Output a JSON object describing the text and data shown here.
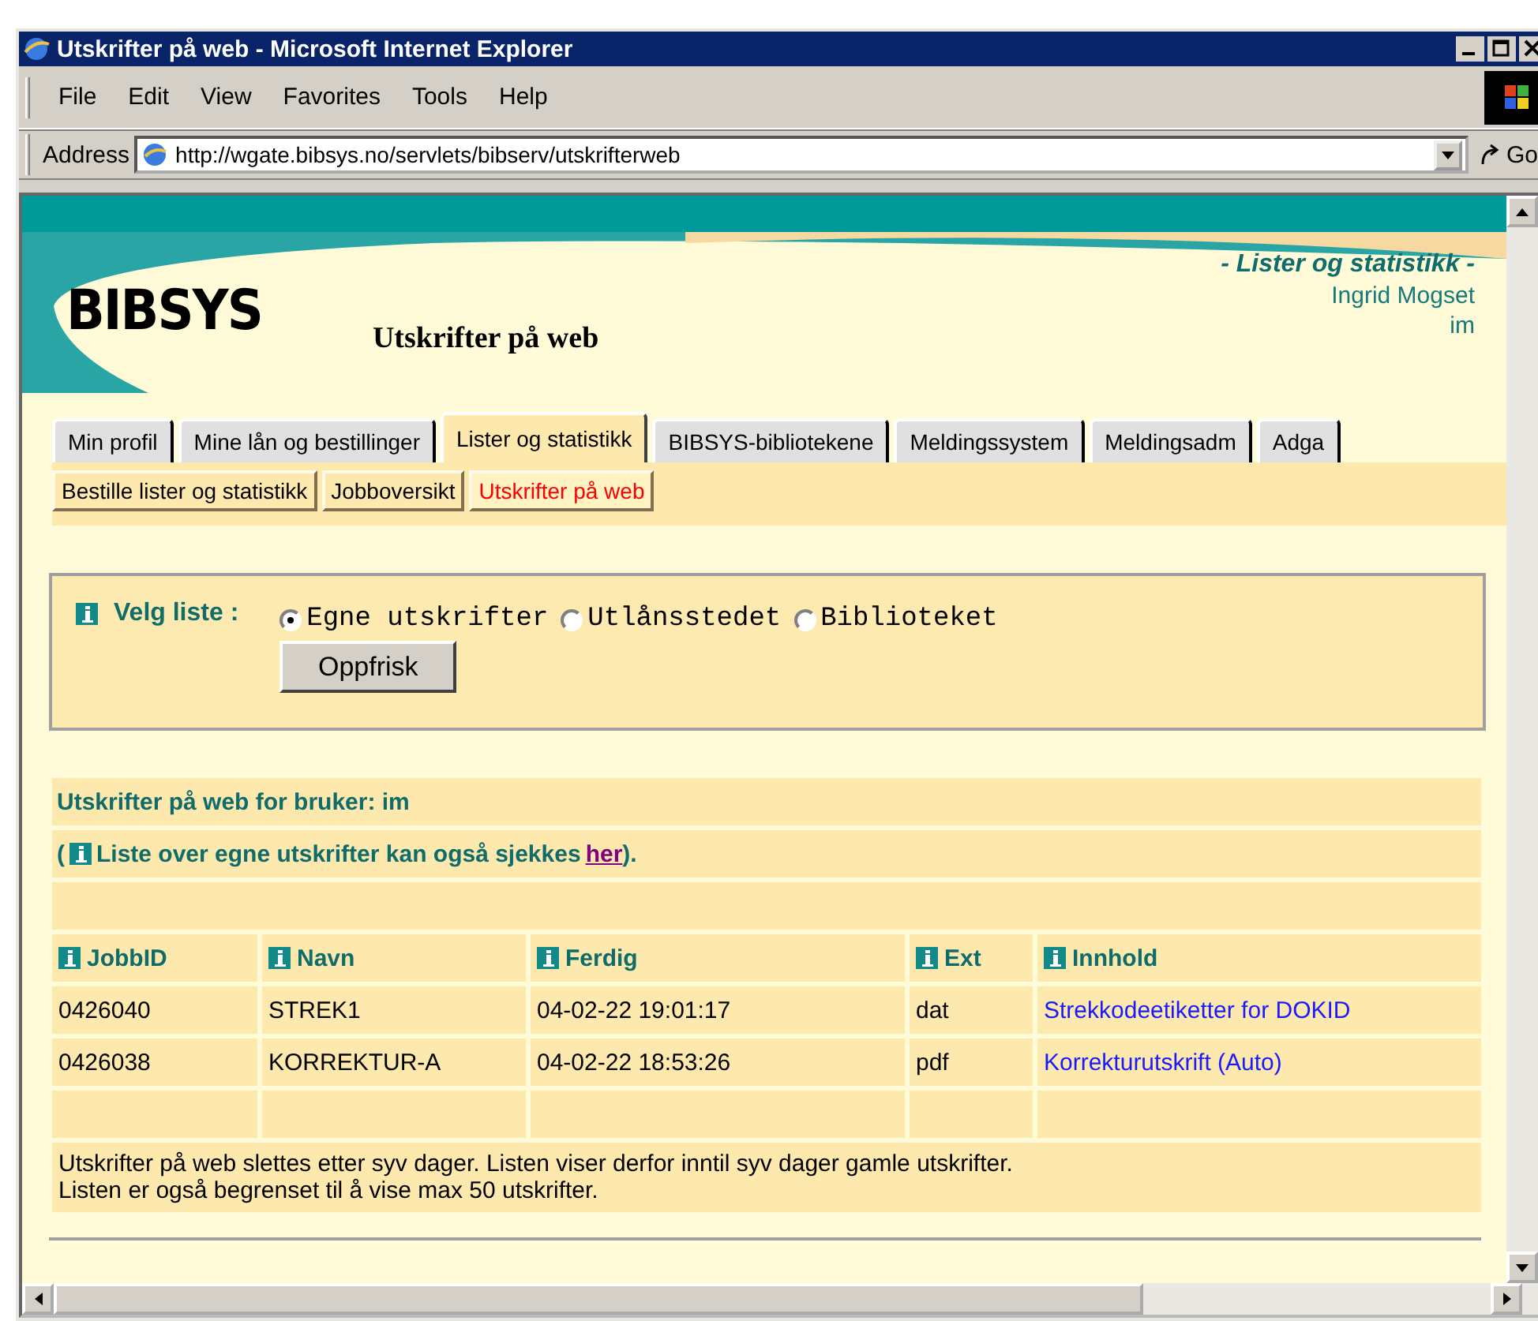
{
  "window": {
    "title": "Utskrifter på web - Microsoft Internet Explorer"
  },
  "menu": [
    "File",
    "Edit",
    "View",
    "Favorites",
    "Tools",
    "Help"
  ],
  "address": {
    "label": "Address",
    "url": "http://wgate.bibsys.no/servlets/bibserv/utskrifterweb",
    "go": "Go"
  },
  "header": {
    "logo": "BIBSYS",
    "page_title": "Utskrifter på web",
    "section": "- Lister og statistikk -",
    "user_name": "Ingrid Mogset",
    "user_id": "im"
  },
  "tabs": [
    {
      "label": "Min profil",
      "selected": false
    },
    {
      "label": "Mine lån og bestillinger",
      "selected": false
    },
    {
      "label": "Lister og statistikk",
      "selected": true
    },
    {
      "label": "BIBSYS-bibliotekene",
      "selected": false
    },
    {
      "label": "Meldingssystem",
      "selected": false
    },
    {
      "label": "Meldingsadm",
      "selected": false
    },
    {
      "label": "Adga",
      "selected": false
    }
  ],
  "subtabs": [
    {
      "label": "Bestille lister og statistikk",
      "selected": false
    },
    {
      "label": "Jobboversikt",
      "selected": false
    },
    {
      "label": "Utskrifter på web",
      "selected": true
    }
  ],
  "form": {
    "label": "Velg liste :",
    "options": [
      {
        "label": "Egne utskrifter",
        "selected": true
      },
      {
        "label": "Utlånsstedet",
        "selected": false
      },
      {
        "label": "Biblioteket",
        "selected": false
      }
    ],
    "button": "Oppfrisk"
  },
  "results": {
    "heading": "Utskrifter på web for bruker: im",
    "note_open": "(",
    "note_text": "Liste over egne utskrifter kan også sjekkes",
    "note_link": "her",
    "note_close": ")."
  },
  "table": {
    "columns": [
      "JobbID",
      "Navn",
      "Ferdig",
      "Ext",
      "Innhold"
    ],
    "rows": [
      {
        "cells": [
          "0426040",
          "STREK1",
          "04-02-22 19:01:17",
          "dat",
          "Strekkodeetiketter for DOKID"
        ]
      },
      {
        "cells": [
          "0426038",
          "KORREKTUR-A",
          "04-02-22 18:53:26",
          "pdf",
          "Korrekturutskrift (Auto)"
        ]
      }
    ]
  },
  "footer": [
    "Utskrifter på web slettes etter syv dager. Listen viser derfor inntil syv dager gamle utskrifter.",
    "Listen er også begrenset til å vise max 50 utskrifter."
  ]
}
